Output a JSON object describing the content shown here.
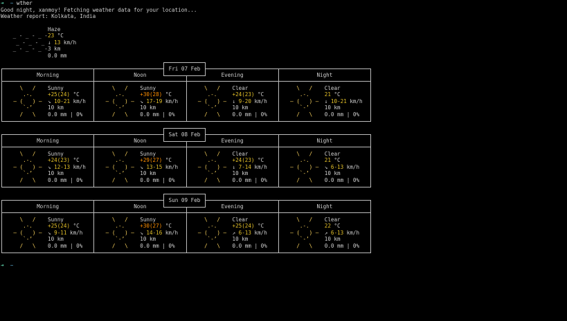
{
  "terminal": {
    "prompt_arrow": "➜",
    "prompt_dir": "~",
    "command": "wther",
    "greeting": "Good night, xanmoy! Fetching weather data for your location...",
    "report_title": "Weather report: Kolkata, India",
    "cursor_line": "➜  ~"
  },
  "current": {
    "condition": "Haze",
    "temperature": "23",
    "temp_unit": "°C",
    "wind_arrow": "↓",
    "wind_speed": "13",
    "wind_unit": "km/h",
    "visibility": "3 km",
    "precipitation": "0.0 mm",
    "icon": "haze-icon",
    "icon_lines": [
      " _ - _ - _ -",
      "  _ - _ - _",
      " _ - _ - _ -"
    ]
  },
  "periods": [
    "Morning",
    "Noon",
    "Evening",
    "Night"
  ],
  "days": [
    {
      "date": "Fri 07 Feb",
      "slots": [
        {
          "condition": "Sunny",
          "icon": "sun-icon",
          "temp_a": "+25",
          "temp_b": "(24)",
          "temp_unit": "°C",
          "wind_arrow": "↘",
          "wind": "10-21",
          "wind_unit": "km/h",
          "visibility": "10 km",
          "precip": "0.0 mm | 0%"
        },
        {
          "condition": "Sunny",
          "icon": "sun-icon",
          "temp_a": "+30",
          "temp_b": "(28)",
          "temp_unit": "°C",
          "wind_arrow": "↘",
          "wind": "17-19",
          "wind_unit": "km/h",
          "visibility": "10 km",
          "precip": "0.0 mm | 0%"
        },
        {
          "condition": "Clear",
          "icon": "sun-icon",
          "temp_a": "+24",
          "temp_b": "(23)",
          "temp_unit": "°C",
          "wind_arrow": "↓",
          "wind": "9-20",
          "wind_unit": "km/h",
          "visibility": "10 km",
          "precip": "0.0 mm | 0%"
        },
        {
          "condition": "Clear",
          "icon": "sun-icon",
          "temp_a": "21",
          "temp_b": "",
          "temp_unit": "°C",
          "wind_arrow": "↓",
          "wind": "10-21",
          "wind_unit": "km/h",
          "visibility": "10 km",
          "precip": "0.0 mm | 0%"
        }
      ]
    },
    {
      "date": "Sat 08 Feb",
      "slots": [
        {
          "condition": "Sunny",
          "icon": "sun-icon",
          "temp_a": "+24",
          "temp_b": "(23)",
          "temp_unit": "°C",
          "wind_arrow": "↘",
          "wind": "12-13",
          "wind_unit": "km/h",
          "visibility": "10 km",
          "precip": "0.0 mm | 0%"
        },
        {
          "condition": "Sunny",
          "icon": "sun-icon",
          "temp_a": "+29",
          "temp_b": "(27)",
          "temp_unit": "°C",
          "wind_arrow": "↘",
          "wind": "13-15",
          "wind_unit": "km/h",
          "visibility": "10 km",
          "precip": "0.0 mm | 0%"
        },
        {
          "condition": "Clear",
          "icon": "sun-icon",
          "temp_a": "+24",
          "temp_b": "(23)",
          "temp_unit": "°C",
          "wind_arrow": "↓",
          "wind": "7-14",
          "wind_unit": "km/h",
          "visibility": "10 km",
          "precip": "0.0 mm | 0%"
        },
        {
          "condition": "Clear",
          "icon": "sun-icon",
          "temp_a": "21",
          "temp_b": "",
          "temp_unit": "°C",
          "wind_arrow": "↘",
          "wind": "6-13",
          "wind_unit": "km/h",
          "visibility": "10 km",
          "precip": "0.0 mm | 0%"
        }
      ]
    },
    {
      "date": "Sun 09 Feb",
      "slots": [
        {
          "condition": "Sunny",
          "icon": "sun-icon",
          "temp_a": "+25",
          "temp_b": "(24)",
          "temp_unit": "°C",
          "wind_arrow": "↘",
          "wind": "9-11",
          "wind_unit": "km/h",
          "visibility": "10 km",
          "precip": "0.0 mm | 0%"
        },
        {
          "condition": "Sunny",
          "icon": "sun-icon",
          "temp_a": "+30",
          "temp_b": "(27)",
          "temp_unit": "°C",
          "wind_arrow": "↘",
          "wind": "14-16",
          "wind_unit": "km/h",
          "visibility": "10 km",
          "precip": "0.0 mm | 0%"
        },
        {
          "condition": "Clear",
          "icon": "sun-icon",
          "temp_a": "+25",
          "temp_b": "(24)",
          "temp_unit": "°C",
          "wind_arrow": "↗",
          "wind": "6-13",
          "wind_unit": "km/h",
          "visibility": "10 km",
          "precip": "0.0 mm | 0%"
        },
        {
          "condition": "Clear",
          "icon": "sun-icon",
          "temp_a": "22",
          "temp_b": "",
          "temp_unit": "°C",
          "wind_arrow": "↗",
          "wind": "6-13",
          "wind_unit": "km/h",
          "visibility": "10 km",
          "precip": "0.0 mm | 0%"
        }
      ]
    }
  ],
  "sun_icon_lines": [
    "\\   /",
    ".-.",
    "― (   ) ―",
    "`-’",
    "/   \\"
  ],
  "colors": {
    "background": "#000000",
    "text": "#d0d0d0",
    "border": "#bdbdbd",
    "sun": "#ffd75f",
    "temp_warm": "#ffaf00",
    "temp_mild": "#e6c229",
    "prompt": "#5fd7af"
  }
}
